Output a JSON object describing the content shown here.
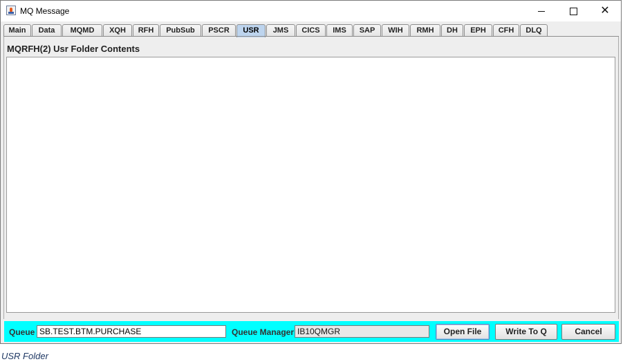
{
  "window": {
    "title": "MQ Message"
  },
  "window_controls": {
    "minimize": "minimize-icon",
    "maximize": "maximize-icon",
    "close": "✕"
  },
  "tabs": [
    {
      "label": "Main",
      "active": false
    },
    {
      "label": "Data",
      "active": false
    },
    {
      "label": "MQMD",
      "active": false
    },
    {
      "label": "XQH",
      "active": false
    },
    {
      "label": "RFH",
      "active": false
    },
    {
      "label": "PubSub",
      "active": false
    },
    {
      "label": "PSCR",
      "active": false
    },
    {
      "label": "USR",
      "active": true
    },
    {
      "label": "JMS",
      "active": false
    },
    {
      "label": "CICS",
      "active": false
    },
    {
      "label": "IMS",
      "active": false
    },
    {
      "label": "SAP",
      "active": false
    },
    {
      "label": "WIH",
      "active": false
    },
    {
      "label": "RMH",
      "active": false
    },
    {
      "label": "DH",
      "active": false
    },
    {
      "label": "EPH",
      "active": false
    },
    {
      "label": "CFH",
      "active": false
    },
    {
      "label": "DLQ",
      "active": false
    }
  ],
  "panel": {
    "heading": "MQRFH(2) Usr Folder Contents",
    "contents": ""
  },
  "bottom_bar": {
    "queue_label": "Queue",
    "queue_value": "SB.TEST.BTM.PURCHASE",
    "queue_manager_label": "Queue Manager",
    "queue_manager_value": "IB10QMGR",
    "open_file_label": "Open File",
    "write_to_q_label": "Write To Q",
    "cancel_label": "Cancel"
  },
  "caption": "USR Folder",
  "colors": {
    "bottom_bar_bg": "#00FFFF",
    "active_tab_bg": "#BDD4EE",
    "caption_text": "#1F3864"
  }
}
